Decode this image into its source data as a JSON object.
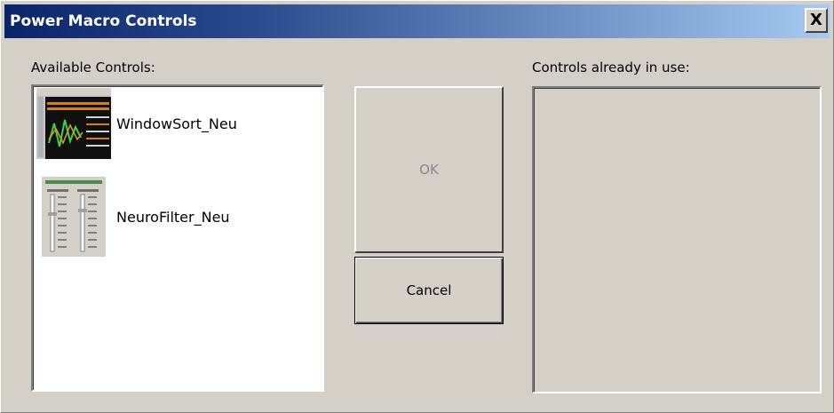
{
  "window": {
    "title": "Power Macro Controls",
    "close_symbol": "X"
  },
  "available": {
    "label": "Available Controls:",
    "items": [
      {
        "name": "WindowSort_Neu",
        "icon": "windowsort-thumbnail-icon"
      },
      {
        "name": "NeuroFilter_Neu",
        "icon": "neurofilter-thumbnail-icon"
      }
    ]
  },
  "in_use": {
    "label": "Controls already in use:",
    "items": []
  },
  "buttons": {
    "ok_label": "OK",
    "ok_enabled": false,
    "cancel_label": "Cancel"
  },
  "colors": {
    "titlebar_start": "#0a246a",
    "titlebar_end": "#a6caf0",
    "dialog_face": "#d4d0c8",
    "disabled_text": "#8a8a8a"
  }
}
